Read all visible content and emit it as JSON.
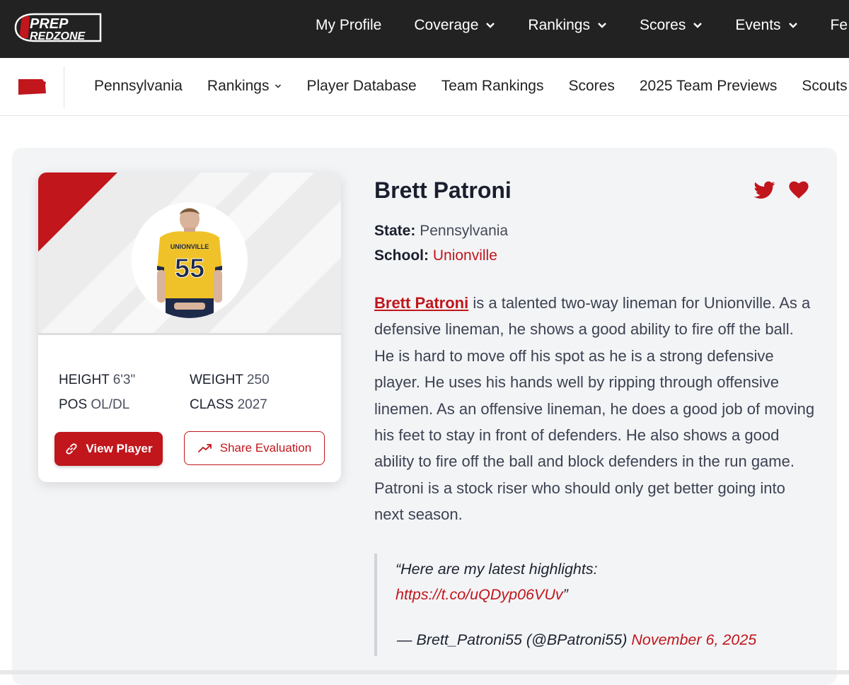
{
  "brand": {
    "logo_top": "PREP",
    "logo_bottom": "REDZONE"
  },
  "topnav": [
    {
      "label": "My Profile",
      "has_chevron": false
    },
    {
      "label": "Coverage",
      "has_chevron": true
    },
    {
      "label": "Rankings",
      "has_chevron": true
    },
    {
      "label": "Scores",
      "has_chevron": true
    },
    {
      "label": "Events",
      "has_chevron": true
    },
    {
      "label": "Fe",
      "has_chevron": false
    }
  ],
  "subnav": [
    {
      "label": "Pennsylvania"
    },
    {
      "label": "Rankings"
    },
    {
      "label": "Player Database"
    },
    {
      "label": "Team Rankings"
    },
    {
      "label": "Scores"
    },
    {
      "label": "2025 Team Previews"
    },
    {
      "label": "Scouts"
    }
  ],
  "player": {
    "jersey_text": "UNIONVILLE",
    "jersey_number": "55",
    "name": "Brett Patroni",
    "state_label": "State:",
    "state_value": "Pennsylvania",
    "school_label": "School:",
    "school_value": "Unionville",
    "height_label": "HEIGHT",
    "height_value": "6'3\"",
    "weight_label": "WEIGHT",
    "weight_value": "250",
    "pos_label": "POS",
    "pos_value": "OL/DL",
    "class_label": "CLASS",
    "class_value": "2027"
  },
  "buttons": {
    "view_player": "View Player",
    "share_evaluation": "Share Evaluation"
  },
  "bio": {
    "name_link": "Brett Patroni",
    "text": " is a talented two-way lineman for Unionville. As a defensive lineman, he shows a good ability to fire off the ball. He is hard to move off his spot as he is a strong defensive player. He uses his hands well by ripping through offensive linemen. As an offensive lineman, he does a good job of moving his feet to stay in front of defenders. He also shows a good ability to fire off the ball and block defenders in the run game. Patroni is a stock riser who should only get better going into next season."
  },
  "quote": {
    "text": "“Here are my latest highlights:",
    "link": "https://t.co/uQDyp06VUv",
    "close": "”",
    "attribution": "— Brett_Patroni55 (@BPatroni55)",
    "date": "November 6, 2025"
  },
  "colors": {
    "accent": "#c0161c",
    "topbar": "#222222",
    "panel": "#f3f4f6"
  },
  "icons": [
    "twitter-icon",
    "heart-icon",
    "link-icon",
    "trend-icon",
    "chevron-down-icon",
    "pennsylvania-flag-icon"
  ]
}
